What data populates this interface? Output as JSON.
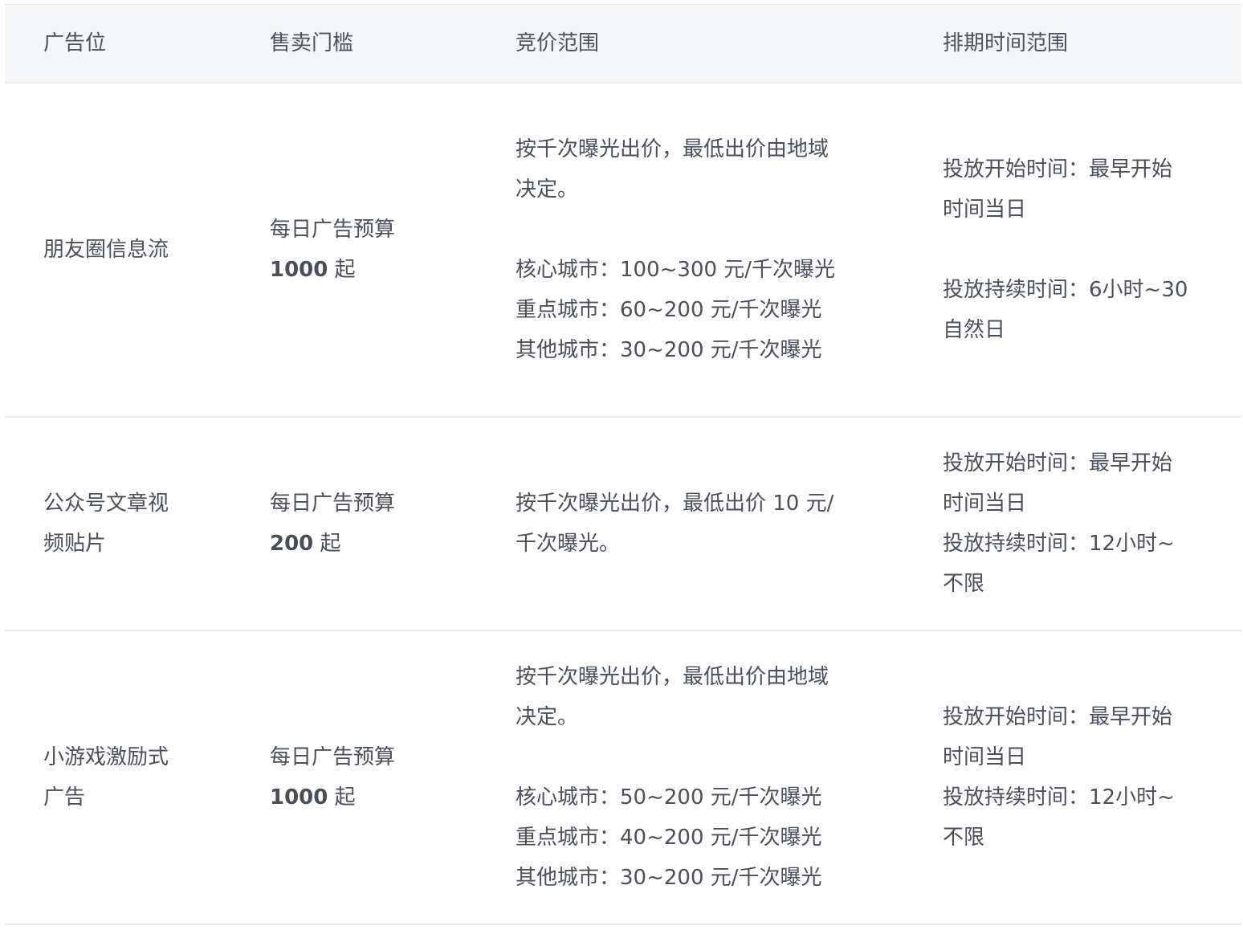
{
  "headers": {
    "position": "广告位",
    "threshold": "售卖门槛",
    "bid_range": "竞价范围",
    "schedule": "排期时间范围"
  },
  "rows": [
    {
      "position_lines": [
        "朋友圈信息流"
      ],
      "threshold_label": "每日广告预算",
      "threshold_amount": "1000",
      "threshold_suffix": " 起",
      "bid_intro_lines": [
        "按千次曝光出价，最低出价由地域",
        "决定。"
      ],
      "bid_cities": [
        "核心城市：100~300 元/千次曝光",
        "重点城市：60~200 元/千次曝光",
        "其他城市：30~200 元/千次曝光"
      ],
      "schedule_start_lines": [
        "投放开始时间：最早开始",
        "时间当日"
      ],
      "schedule_duration_lines": [
        "投放持续时间：6小时~30",
        "自然日"
      ]
    },
    {
      "position_lines": [
        "公众号文章视",
        "频贴片"
      ],
      "threshold_label": "每日广告预算",
      "threshold_amount": "200",
      "threshold_suffix": " 起",
      "bid_intro_lines": [
        "按千次曝光出价，最低出价 10 元/",
        "千次曝光。"
      ],
      "schedule_start_lines": [
        "投放开始时间：最早开始",
        "时间当日"
      ],
      "schedule_duration_lines": [
        "投放持续时间：12小时~",
        "不限"
      ]
    },
    {
      "position_lines": [
        "小游戏激励式",
        "广告"
      ],
      "threshold_label": "每日广告预算",
      "threshold_amount": "1000",
      "threshold_suffix": " 起",
      "bid_intro_lines": [
        "按千次曝光出价，最低出价由地域",
        "决定。"
      ],
      "bid_cities": [
        "核心城市：50~200 元/千次曝光",
        "重点城市：40~200 元/千次曝光",
        "其他城市：30~200 元/千次曝光"
      ],
      "schedule_start_lines": [
        "投放开始时间：最早开始",
        "时间当日"
      ],
      "schedule_duration_lines": [
        "投放持续时间：12小时~",
        "不限"
      ]
    }
  ]
}
